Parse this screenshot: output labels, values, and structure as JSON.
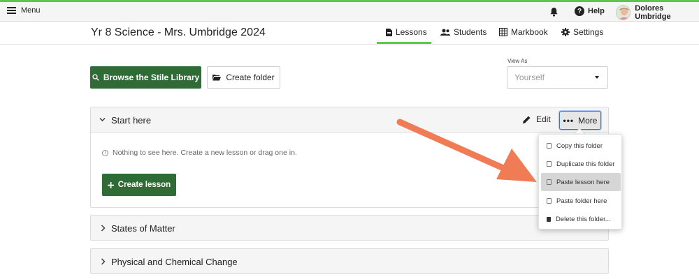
{
  "topbar": {
    "menu_label": "Menu",
    "help_label": "Help",
    "help_symbol": "?",
    "user_name": "Dolores Umbridge"
  },
  "subheader": {
    "class_title": "Yr 8 Science - Mrs. Umbridge 2024",
    "tabs": [
      {
        "label": "Lessons",
        "icon": "document-icon",
        "active": true
      },
      {
        "label": "Students",
        "icon": "people-icon",
        "active": false
      },
      {
        "label": "Markbook",
        "icon": "grid-icon",
        "active": false
      },
      {
        "label": "Settings",
        "icon": "gear-icon",
        "active": false
      }
    ]
  },
  "toolbar": {
    "browse_label": "Browse the Stile Library",
    "create_folder_label": "Create folder",
    "view_as_label": "View As",
    "view_as_value": "Yourself"
  },
  "folders": [
    {
      "title": "Start here",
      "expanded": true,
      "edit_label": "Edit",
      "more_label": "More",
      "empty_message": "Nothing to see here. Create a new lesson or drag one in.",
      "create_lesson_label": "Create lesson"
    },
    {
      "title": "States of Matter",
      "expanded": false
    },
    {
      "title": "Physical and Chemical Change",
      "expanded": false
    }
  ],
  "more_menu": {
    "items": [
      {
        "label": "Copy this folder",
        "icon": "copy-icon",
        "highlighted": false
      },
      {
        "label": "Duplicate this folder",
        "icon": "copy-icon",
        "highlighted": false
      },
      {
        "label": "Paste lesson here",
        "icon": "copy-icon",
        "highlighted": true
      },
      {
        "label": "Paste folder here",
        "icon": "copy-icon",
        "highlighted": false
      },
      {
        "label": "Delete this folder...",
        "icon": "trash-icon",
        "highlighted": false
      }
    ]
  },
  "colors": {
    "accent_green": "#5ac94a",
    "button_green": "#2e6b35",
    "annotation_arrow": "#f07c55",
    "focus_blue": "#3d6fd6"
  }
}
